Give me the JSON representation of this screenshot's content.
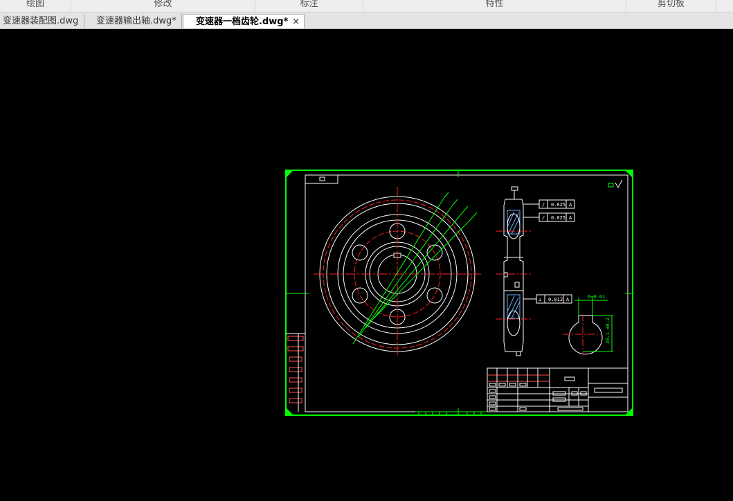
{
  "ribbon": {
    "groups": [
      "绘图",
      "修改",
      "标注",
      "特性",
      "剪切板"
    ]
  },
  "tabs": [
    {
      "label": "变速器装配图.dwg",
      "active": false
    },
    {
      "label": "变速器输出轴.dwg*",
      "active": false
    },
    {
      "label": "变速器一档齿轮.dwg*",
      "active": true
    }
  ],
  "tab_close_glyph": "×",
  "drawing": {
    "tolerance_1": "0.025",
    "tolerance_2": "0.025",
    "tolerance_3": "0.012",
    "keyway_width": "6±0.01",
    "keyway_depth": "30.1 ±0.2"
  },
  "colors": {
    "frame_green": "#00ff00",
    "line_white": "#ffffff",
    "center_red": "#ff2020",
    "hatch_blue": "#6bb0ff"
  }
}
